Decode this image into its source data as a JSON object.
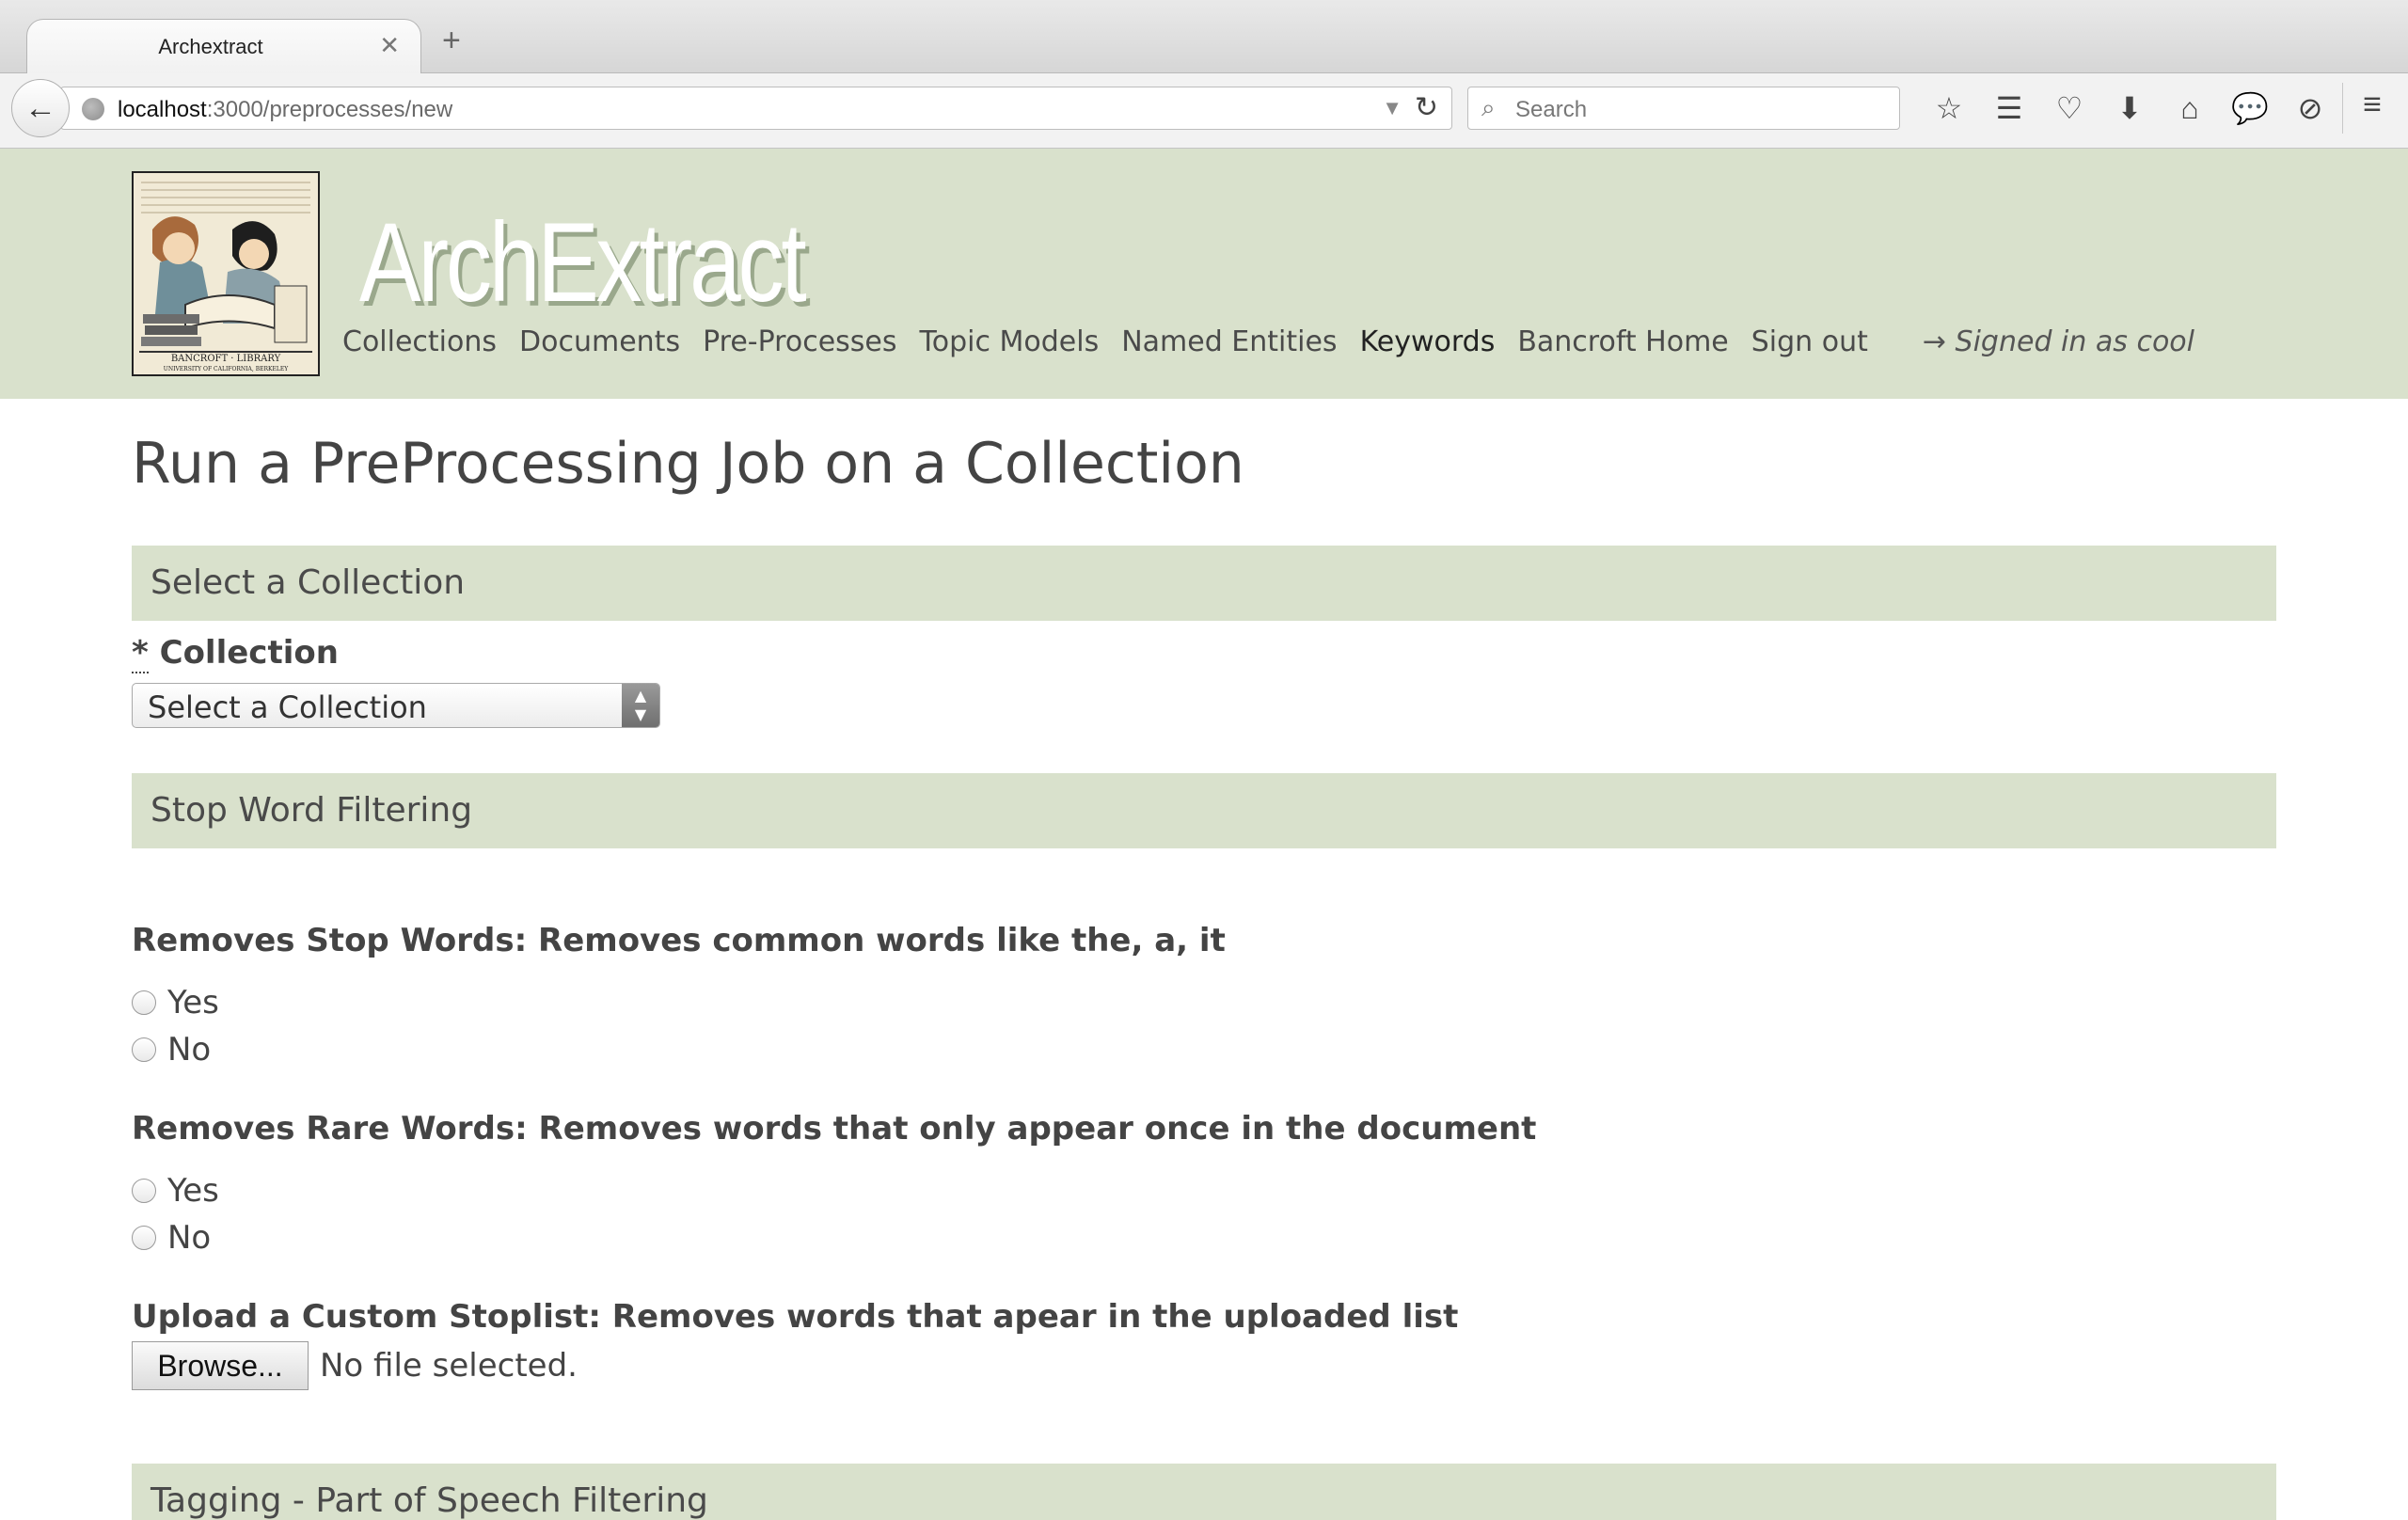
{
  "browser": {
    "tab_title": "Archextract",
    "tab_close": "✕",
    "new_tab": "+",
    "url_host": "localhost",
    "url_path": ":3000/preprocesses/new",
    "search_placeholder": "Search"
  },
  "site": {
    "brand": "ArchExtract",
    "nav": [
      "Collections",
      "Documents",
      "Pre-Processes",
      "Topic Models",
      "Named Entities",
      "Keywords",
      "Bancroft Home",
      "Sign out"
    ],
    "signed_in": "→ Signed in as cool"
  },
  "page": {
    "title": "Run a PreProcessing Job on a Collection",
    "section_collection": "Select a Collection",
    "collection_required_mark": "*",
    "collection_label": "Collection",
    "collection_select_value": "Select a Collection",
    "section_stopwords": "Stop Word Filtering",
    "stop_words_question": "Removes Stop Words: Removes common words like the, a, it",
    "stop_words_options": [
      "Yes",
      "No"
    ],
    "rare_words_question": "Removes Rare Words: Removes words that only appear once in the document",
    "rare_words_options": [
      "Yes",
      "No"
    ],
    "custom_stoplist_label": "Upload a Custom Stoplist: Removes words that apear in the uploaded list",
    "browse_button": "Browse...",
    "file_status": "No file selected.",
    "section_tagging": "Tagging - Part of Speech Filtering"
  }
}
